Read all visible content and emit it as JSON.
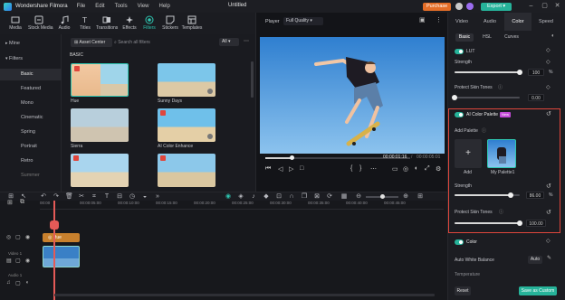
{
  "app": {
    "name": "Wondershare Filmora",
    "menu": [
      "File",
      "Edit",
      "Tools",
      "View",
      "Help"
    ],
    "project_title": "Untitled",
    "purchase_label": "Purchase",
    "export_label": "Export"
  },
  "toolbar": {
    "tabs": [
      "Media",
      "Stock Media",
      "Audio",
      "Titles",
      "Transitions",
      "Effects",
      "Filters",
      "Stickers",
      "Templates"
    ],
    "active": "Filters"
  },
  "sidebar": {
    "mine": "Mine",
    "filters": "Filters",
    "items": [
      "Basic",
      "Featured",
      "Mono",
      "Cinematic",
      "Spring",
      "Portrait",
      "Retro",
      "Summer"
    ],
    "selected": "Basic"
  },
  "library": {
    "account_center": "Asset Center",
    "search_placeholder": "Search all filters",
    "filter_all": "All",
    "section": "BASIC",
    "thumbs": [
      "Hue",
      "Sunny Days",
      "Sierra",
      "AI Color Enhance",
      "",
      ""
    ]
  },
  "player": {
    "label": "Player",
    "quality": "Full Quality",
    "time_current": "00:00:01:16",
    "time_total": "00:00:05:01",
    "progress": 0.18
  },
  "panel": {
    "tabs": [
      "Video",
      "Audio",
      "Color",
      "Speed"
    ],
    "active_tab": "Color",
    "subtabs": [
      "Basic",
      "HSL",
      "Curves"
    ],
    "active_subtab": "Basic",
    "lut": {
      "label": "LUT",
      "strength_label": "Strength",
      "strength_value": "100",
      "strength_unit": "%",
      "strength": 1.0,
      "protect_label": "Protect Skin Tones",
      "protect_value": "0.00",
      "protect": 0.0
    },
    "ai_palette": {
      "label": "AI Color Palette",
      "badge": "New",
      "add_palette_label": "Add Palette",
      "add_label": "Add",
      "palette_name": "My Palette1",
      "strength_label": "Strength",
      "strength_value": "86.00",
      "strength_unit": "%",
      "strength": 0.86,
      "protect_label": "Protect Skin Tones",
      "protect_value": "100.00",
      "protect": 1.0
    },
    "color": {
      "label": "Color",
      "white_balance_label": "Auto White Balance",
      "white_balance_btn": "Auto",
      "temperature_label": "Temperature"
    },
    "reset_label": "Reset",
    "save_custom_label": "Save as Custom"
  },
  "timeline": {
    "ruler": [
      "00:00",
      "00:00:05:00",
      "00:00:10:00",
      "00:00:15:00",
      "00:00:20:00",
      "00:00:25:00",
      "00:00:30:00",
      "00:00:35:00",
      "00:00:40:00",
      "00:00:45:00"
    ],
    "filter_clip_label": "Hue",
    "track_labels": [
      "Video 1",
      "Audio 1"
    ]
  },
  "colors": {
    "accent": "#26b39a",
    "highlight_border": "#e0463c",
    "playhead": "#e45a57",
    "filter_clip": "#c8802d",
    "purchase": "#e36d27"
  }
}
